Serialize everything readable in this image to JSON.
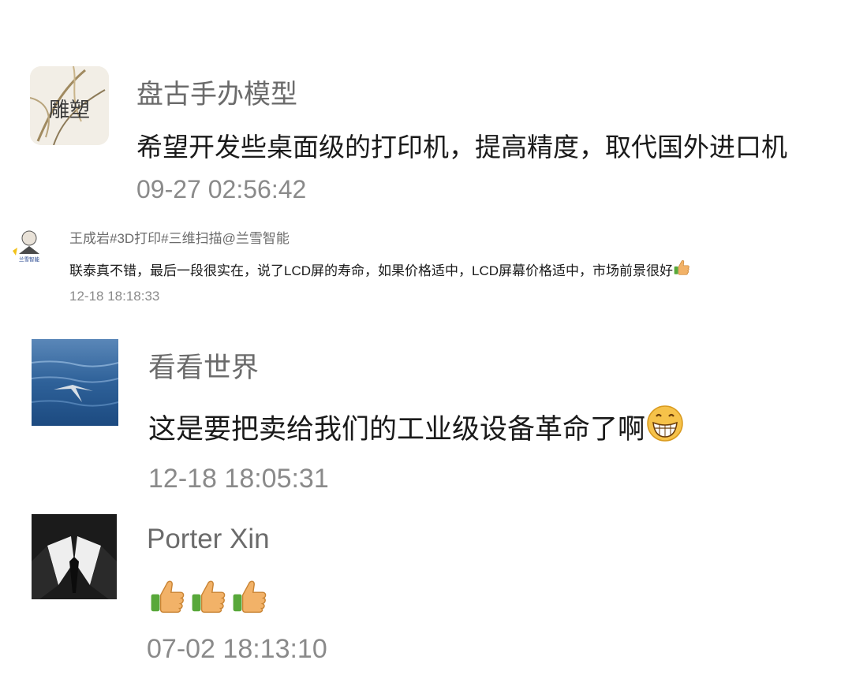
{
  "comments": [
    {
      "name": "盘古手办模型",
      "avatar_text": "雕塑",
      "text": "希望开发些桌面级的打印机，提高精度，取代国外进口机",
      "time": "09-27 02:56:42"
    },
    {
      "name": "王成岩#3D打印#三维扫描@兰雪智能",
      "avatar_text": "兰雪智能",
      "text": "联泰真不错，最后一段很实在，说了LCD屏的寿命，如果价格适中，LCD屏幕价格适中，市场前景很好",
      "emoji": "thumbs-up-icon",
      "time": "12-18 18:18:33"
    },
    {
      "name": "看看世界",
      "text": "这是要把卖给我们的工业级设备革命了啊",
      "emoji": "grinning-face-icon",
      "time": "12-18 18:05:31"
    },
    {
      "name": "Porter Xin",
      "text": "",
      "emoji": "thumbs-up-icon",
      "emoji_count": 3,
      "time": "07-02 18:13:10"
    }
  ]
}
